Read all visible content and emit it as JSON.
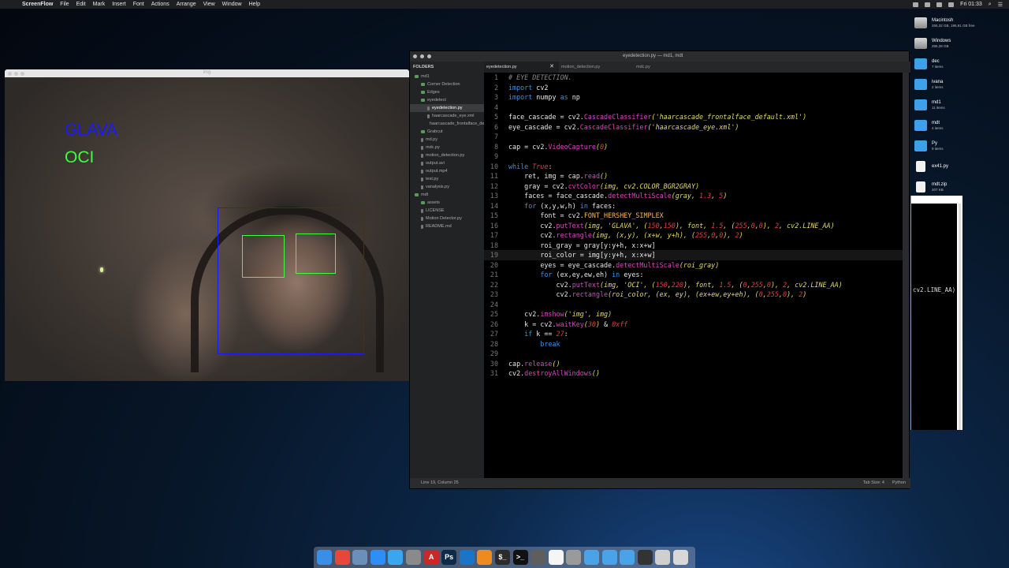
{
  "menubar": {
    "apple": "",
    "app": "ScreenFlow",
    "items": [
      "File",
      "Edit",
      "Mark",
      "Insert",
      "Font",
      "Actions",
      "Arrange",
      "View",
      "Window",
      "Help"
    ],
    "clock": "Fri 01:33"
  },
  "desktop": [
    {
      "title": "Macintosh",
      "sub": "255,32 GB, 195,91 GB free",
      "kind": "drive"
    },
    {
      "title": "Windows",
      "sub": "255,28 GB",
      "kind": "drive"
    },
    {
      "title": "dec",
      "sub": "7 items",
      "kind": "folder"
    },
    {
      "title": "ivana",
      "sub": "2 items",
      "kind": "folder"
    },
    {
      "title": "md1",
      "sub": "11 items",
      "kind": "folder"
    },
    {
      "title": "mdt",
      "sub": "4 items",
      "kind": "folder"
    },
    {
      "title": "Py",
      "sub": "9 items",
      "kind": "folder"
    },
    {
      "title": "ex41.py",
      "sub": "",
      "kind": "file"
    },
    {
      "title": "mdt.zip",
      "sub": "207 KB",
      "kind": "file"
    }
  ],
  "side_snippet": "cv2.LINE_AA)",
  "img_window": {
    "title": "img",
    "label_face": "GLAVA",
    "label_eye": "OCI",
    "label_face_color": "#1a1aff",
    "label_eye_color": "#3cff3c"
  },
  "editor": {
    "title": "eyedetection.py — md1, mdt",
    "folders_header": "FOLDERS",
    "tree": [
      {
        "label": "md1",
        "depth": 0,
        "type": "folder"
      },
      {
        "label": "Corner Detection",
        "depth": 1,
        "type": "folder"
      },
      {
        "label": "Edges",
        "depth": 1,
        "type": "folder"
      },
      {
        "label": "eyedetect",
        "depth": 1,
        "type": "folder"
      },
      {
        "label": "eyedetection.py",
        "depth": 2,
        "type": "file",
        "selected": true
      },
      {
        "label": "haarcascade_eye.xml",
        "depth": 2,
        "type": "file"
      },
      {
        "label": "haarcascade_frontalface_default.xml",
        "depth": 2,
        "type": "file"
      },
      {
        "label": "Grabcut",
        "depth": 1,
        "type": "folder"
      },
      {
        "label": "md.py",
        "depth": 1,
        "type": "file"
      },
      {
        "label": "mdc.py",
        "depth": 1,
        "type": "file"
      },
      {
        "label": "motion_detection.py",
        "depth": 1,
        "type": "file"
      },
      {
        "label": "output.avi",
        "depth": 1,
        "type": "file"
      },
      {
        "label": "output.mp4",
        "depth": 1,
        "type": "file"
      },
      {
        "label": "test.py",
        "depth": 1,
        "type": "file"
      },
      {
        "label": "vanalysis.py",
        "depth": 1,
        "type": "file"
      },
      {
        "label": "mdt",
        "depth": 0,
        "type": "folder"
      },
      {
        "label": "assets",
        "depth": 1,
        "type": "folder"
      },
      {
        "label": "LICENSE",
        "depth": 1,
        "type": "file"
      },
      {
        "label": "Motion Detector.py",
        "depth": 1,
        "type": "file"
      },
      {
        "label": "README.md",
        "depth": 1,
        "type": "file"
      }
    ],
    "tabs": [
      {
        "label": "eyedetection.py",
        "active": true,
        "close": "✕"
      },
      {
        "label": "motion_detection.py",
        "active": false
      },
      {
        "label": "mdc.py",
        "active": false
      }
    ],
    "current_line": 19,
    "code": [
      [
        [
          "cm",
          "# EYE DETECTION."
        ]
      ],
      [
        [
          "kw",
          "import"
        ],
        [
          "",
          " cv2"
        ]
      ],
      [
        [
          "kw",
          "import"
        ],
        [
          "",
          " numpy "
        ],
        [
          "kw",
          "as"
        ],
        [
          "",
          " np"
        ]
      ],
      [],
      [
        [
          "",
          "face_cascade = cv2."
        ],
        [
          "fn",
          "CascadeClassifier"
        ],
        [
          "it",
          "("
        ],
        [
          "str",
          "'haarcascade_frontalface_default.xml'"
        ],
        [
          "it",
          ")"
        ]
      ],
      [
        [
          "",
          "eye_cascade = cv2."
        ],
        [
          "fn",
          "CascadeClassifier"
        ],
        [
          "it",
          "("
        ],
        [
          "str",
          "'haarcascade_eye.xml'"
        ],
        [
          "it",
          ")"
        ]
      ],
      [],
      [
        [
          "",
          "cap = cv2."
        ],
        [
          "fn",
          "VideoCapture"
        ],
        [
          "it",
          "("
        ],
        [
          "num",
          "0"
        ],
        [
          "it",
          ")"
        ]
      ],
      [],
      [
        [
          "kw",
          "while"
        ],
        [
          "",
          " "
        ],
        [
          "kwi",
          "True"
        ],
        [
          "",
          ":"
        ]
      ],
      [
        [
          "",
          "    ret, img = cap."
        ],
        [
          "fn",
          "read"
        ],
        [
          "it",
          "()"
        ]
      ],
      [
        [
          "",
          "    gray = cv2."
        ],
        [
          "fn",
          "cvtColor"
        ],
        [
          "it",
          "(img, cv2.COLOR_BGR2GRAY)"
        ]
      ],
      [
        [
          "",
          "    faces = face_cascade."
        ],
        [
          "fn",
          "detectMultiScale"
        ],
        [
          "it",
          "(gray, "
        ],
        [
          "num",
          "1.3"
        ],
        [
          "it",
          ", "
        ],
        [
          "num",
          "5"
        ],
        [
          "it",
          ")"
        ]
      ],
      [
        [
          "",
          "    "
        ],
        [
          "kw",
          "for"
        ],
        [
          "",
          " (x,y,w,h) "
        ],
        [
          "kw",
          "in"
        ],
        [
          "",
          " faces:"
        ]
      ],
      [
        [
          "",
          "        font = cv2."
        ],
        [
          "cls",
          "FONT_HERSHEY_SIMPLEX"
        ]
      ],
      [
        [
          "",
          "        cv2."
        ],
        [
          "fn",
          "putText"
        ],
        [
          "it",
          "(img, "
        ],
        [
          "str",
          "'GLAVA'"
        ],
        [
          "it",
          ", ("
        ],
        [
          "num",
          "150"
        ],
        [
          "it",
          ","
        ],
        [
          "num",
          "150"
        ],
        [
          "it",
          "), font, "
        ],
        [
          "num",
          "1.5"
        ],
        [
          "it",
          ", ("
        ],
        [
          "num",
          "255"
        ],
        [
          "it",
          ","
        ],
        [
          "num",
          "0"
        ],
        [
          "it",
          ","
        ],
        [
          "num",
          "0"
        ],
        [
          "it",
          "), "
        ],
        [
          "num",
          "2"
        ],
        [
          "it",
          ", cv2.LINE_AA)"
        ]
      ],
      [
        [
          "",
          "        cv2."
        ],
        [
          "fn",
          "rectangle"
        ],
        [
          "it",
          "(img, (x,y), (x+w, y+h), ("
        ],
        [
          "num",
          "255"
        ],
        [
          "it",
          ","
        ],
        [
          "num",
          "0"
        ],
        [
          "it",
          ","
        ],
        [
          "num",
          "0"
        ],
        [
          "it",
          "), "
        ],
        [
          "num",
          "2"
        ],
        [
          "it",
          ")"
        ]
      ],
      [
        [
          "",
          "        roi_gray = gray[y:y+h, x:x+w]"
        ]
      ],
      [
        [
          "",
          "        roi_color = img[y:y+h, x:x+w]"
        ]
      ],
      [
        [
          "",
          "        eyes = eye_cascade."
        ],
        [
          "fn",
          "detectMultiScale"
        ],
        [
          "it",
          "(roi_gray)"
        ]
      ],
      [
        [
          "",
          "        "
        ],
        [
          "kw",
          "for"
        ],
        [
          "",
          " (ex,ey,ew,eh) "
        ],
        [
          "kw",
          "in"
        ],
        [
          "",
          " eyes:"
        ]
      ],
      [
        [
          "",
          "            cv2."
        ],
        [
          "fn",
          "putText"
        ],
        [
          "it",
          "(img, "
        ],
        [
          "str",
          "'OCI'"
        ],
        [
          "it",
          ", ("
        ],
        [
          "num",
          "150"
        ],
        [
          "it",
          ","
        ],
        [
          "num",
          "220"
        ],
        [
          "it",
          "), font, "
        ],
        [
          "num",
          "1.5"
        ],
        [
          "it",
          ", ("
        ],
        [
          "num",
          "0"
        ],
        [
          "it",
          ","
        ],
        [
          "num",
          "255"
        ],
        [
          "it",
          ","
        ],
        [
          "num",
          "0"
        ],
        [
          "it",
          "), "
        ],
        [
          "num",
          "2"
        ],
        [
          "it",
          ", cv2.LINE_AA)"
        ]
      ],
      [
        [
          "",
          "            cv2."
        ],
        [
          "fn",
          "rectangle"
        ],
        [
          "it",
          "(roi_color, (ex, ey), (ex+ew,ey+eh), ("
        ],
        [
          "num",
          "0"
        ],
        [
          "it",
          ","
        ],
        [
          "num",
          "255"
        ],
        [
          "it",
          ","
        ],
        [
          "num",
          "0"
        ],
        [
          "it",
          "), "
        ],
        [
          "num",
          "2"
        ],
        [
          "it",
          ")"
        ]
      ],
      [],
      [
        [
          "",
          "    cv2."
        ],
        [
          "fn",
          "imshow"
        ],
        [
          "it",
          "("
        ],
        [
          "str",
          "'img'"
        ],
        [
          "it",
          ", img)"
        ]
      ],
      [
        [
          "",
          "    k = cv2."
        ],
        [
          "fn",
          "waitKey"
        ],
        [
          "it",
          "("
        ],
        [
          "num",
          "30"
        ],
        [
          "it",
          ")"
        ],
        [
          "",
          " & "
        ],
        [
          "num",
          "0xff"
        ]
      ],
      [
        [
          "",
          "    "
        ],
        [
          "kw",
          "if"
        ],
        [
          "",
          " k == "
        ],
        [
          "num",
          "27"
        ],
        [
          "",
          ":"
        ]
      ],
      [
        [
          "",
          "        "
        ],
        [
          "kw",
          "break"
        ]
      ],
      [],
      [
        [
          "",
          "cap."
        ],
        [
          "fn",
          "release"
        ],
        [
          "it",
          "()"
        ]
      ],
      [
        [
          "",
          "cv2."
        ],
        [
          "fn",
          "destroyAllWindows"
        ],
        [
          "it",
          "()"
        ]
      ]
    ],
    "status_left": "Line 19, Column 25",
    "status_tab": "Tab Size: 4",
    "status_lang": "Python"
  },
  "dock": [
    {
      "name": "finder-icon",
      "color": "#3a8ee6",
      "glyph": ""
    },
    {
      "name": "chrome-icon",
      "color": "#e8453c",
      "glyph": ""
    },
    {
      "name": "preview-icon",
      "color": "#6a8fb8",
      "glyph": ""
    },
    {
      "name": "appstore-icon",
      "color": "#2d8ef5",
      "glyph": ""
    },
    {
      "name": "messages-icon",
      "color": "#3aa6f0",
      "glyph": ""
    },
    {
      "name": "system-preferences-icon",
      "color": "#8a8a8a",
      "glyph": ""
    },
    {
      "name": "acrobat-icon",
      "color": "#c82828",
      "glyph": "A"
    },
    {
      "name": "photoshop-icon",
      "color": "#0d2b48",
      "glyph": "Ps"
    },
    {
      "name": "vscode-icon",
      "color": "#1a74c8",
      "glyph": ""
    },
    {
      "name": "sublime-icon",
      "color": "#ef8b1e",
      "glyph": ""
    },
    {
      "name": "terminal-icon",
      "color": "#2b2b2b",
      "glyph": "$_"
    },
    {
      "name": "terminal2-icon",
      "color": "#111",
      "glyph": ">_"
    },
    {
      "name": "screenflow-icon",
      "color": "#5e5e5e",
      "glyph": ""
    },
    {
      "name": "document-icon",
      "color": "#f5f5f5",
      "glyph": ""
    },
    {
      "name": "gear-icon",
      "color": "#9a9a9a",
      "glyph": ""
    },
    {
      "name": "downloads-folder-icon",
      "color": "#4aa3e8",
      "glyph": ""
    },
    {
      "name": "folder-icon",
      "color": "#4aa3e8",
      "glyph": ""
    },
    {
      "name": "folder2-icon",
      "color": "#4aa3e8",
      "glyph": ""
    },
    {
      "name": "screenshot-icon",
      "color": "#333",
      "glyph": ""
    },
    {
      "name": "drive-icon",
      "color": "#cfcfcf",
      "glyph": ""
    },
    {
      "name": "trash-icon",
      "color": "#d8d8d8",
      "glyph": ""
    }
  ]
}
